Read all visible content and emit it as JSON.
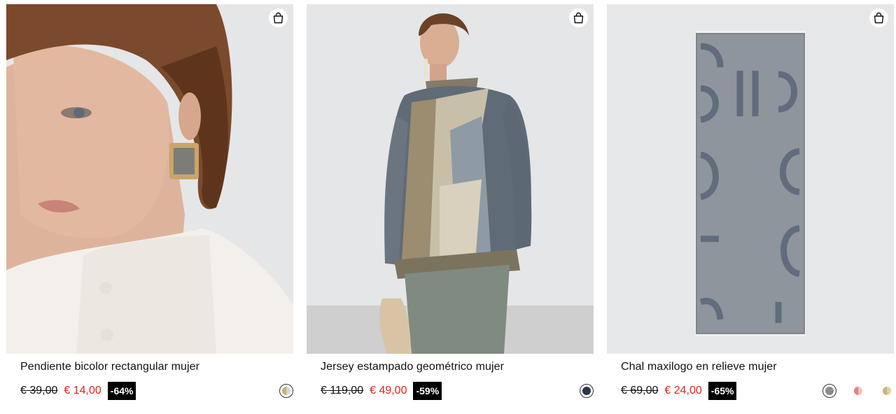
{
  "products": [
    {
      "title": "Pendiente bicolor rectangular mujer",
      "old_price": "€ 39,00",
      "new_price": "€ 14,00",
      "discount": "-64%",
      "swatches": [
        {
          "name": "gold-grey",
          "left": "#c9b07a",
          "right": "#d9d6cf"
        }
      ]
    },
    {
      "title": "Jersey estampado geométrico mujer",
      "old_price": "€ 119,00",
      "new_price": "€ 49,00",
      "discount": "-59%",
      "swatches": [
        {
          "name": "dark-blue",
          "left": "#2d3646",
          "right": "#2d3646"
        }
      ]
    },
    {
      "title": "Chal maxilogo en relieve mujer",
      "old_price": "€ 69,00",
      "new_price": "€ 24,00",
      "discount": "-65%",
      "swatches": [
        {
          "name": "grey",
          "left": "#8a8d92",
          "right": "#8a8d92"
        },
        {
          "name": "coral",
          "left": "#e8807a",
          "right": "#f0c2bd"
        },
        {
          "name": "camel",
          "left": "#cdb282",
          "right": "#e0cfa8"
        }
      ]
    }
  ],
  "icons": {
    "bag": "shopping-bag-icon"
  },
  "colors": {
    "sale": "#e2231a",
    "badge_bg": "#000000"
  }
}
